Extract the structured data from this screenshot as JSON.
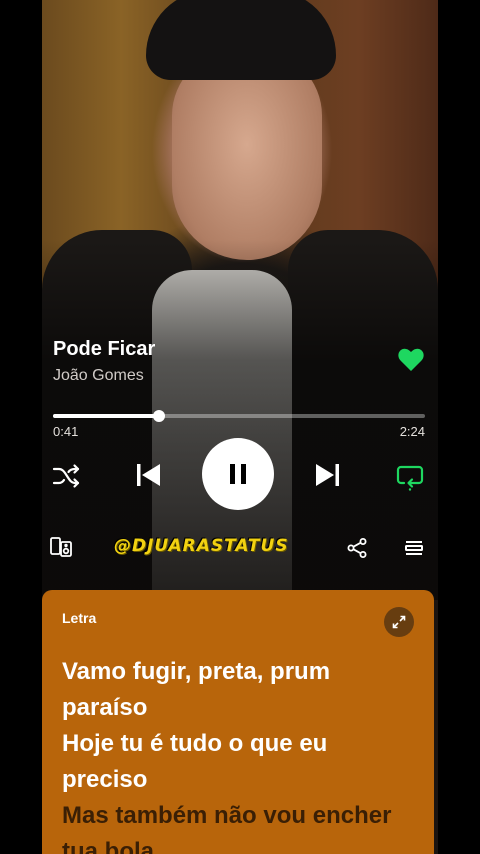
{
  "track": {
    "title": "Pode Ficar",
    "artist": "João Gomes",
    "liked": true
  },
  "playback": {
    "elapsed": "0:41",
    "duration": "2:24",
    "progress_fraction": 0.285,
    "state": "playing"
  },
  "controls": {
    "shuffle_icon": "shuffle-icon",
    "previous_icon": "skip-previous-icon",
    "pause_icon": "pause-icon",
    "next_icon": "skip-next-icon",
    "repeat_icon": "repeat-icon"
  },
  "watermark": "@DJUARASTATUS",
  "lyrics": {
    "heading": "Letra",
    "lines": [
      {
        "text": "Vamo fugir, preta, prum",
        "state": "sung"
      },
      {
        "text": "paraíso",
        "state": "sung"
      },
      {
        "text": "Hoje tu é tudo o que eu",
        "state": "sung"
      },
      {
        "text": "preciso",
        "state": "sung"
      },
      {
        "text": "Mas também não vou encher",
        "state": "upcoming"
      },
      {
        "text": "tua bola",
        "state": "upcoming"
      }
    ]
  },
  "colors": {
    "accent_green": "#1ed760",
    "lyrics_card": "#b8650b",
    "watermark": "#f2d211"
  }
}
